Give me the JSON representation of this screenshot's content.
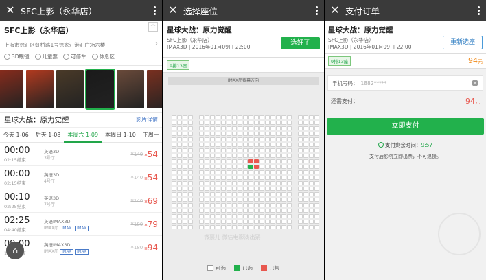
{
  "panel1": {
    "title": "SFC上影（永华店）",
    "cinema_name": "SFC上影（永华店）",
    "address": "上海市徐汇区虹桥路1号徐家汇港汇广场六楼",
    "tags": [
      "3D眼镜",
      "儿童票",
      "可停车",
      "休息区"
    ],
    "movie_title": "星球大战：原力觉醒",
    "movie_detail": "影片详情",
    "dates": [
      "今天 1-06",
      "后天 1-08",
      "本周六 1-09",
      "本周日 1-10",
      "下周一"
    ],
    "active_date_index": 2,
    "showtimes": [
      {
        "time": "00:00",
        "end": "02:15结束",
        "lang": "英语3D",
        "hall": "3号厅",
        "imax": false,
        "old_price": "¥140",
        "price": "54"
      },
      {
        "time": "00:00",
        "end": "02:15结束",
        "lang": "英语3D",
        "hall": "4号厅",
        "imax": false,
        "old_price": "¥140",
        "price": "54"
      },
      {
        "time": "00:10",
        "end": "02:25结束",
        "lang": "英语3D",
        "hall": "7号厅",
        "imax": false,
        "old_price": "¥140",
        "price": "69"
      },
      {
        "time": "02:25",
        "end": "04:40结束",
        "lang": "英语IMAX3D",
        "hall": "IMAX厅",
        "imax": true,
        "imax_labels": [
          "IMAX",
          "IMAX"
        ],
        "old_price": "¥180",
        "price": "79"
      },
      {
        "time": "09:00",
        "end": "11:15结束",
        "lang": "英语IMAX3D",
        "hall": "IMAX厅",
        "imax": true,
        "imax_labels": [
          "IMAX",
          "IMAX"
        ],
        "old_price": "¥180",
        "price": "94"
      }
    ],
    "poster_colors": [
      "#8a2c1c",
      "#b23a1f",
      "#4a3a28",
      "#1a1a1a",
      "#6a4a3a",
      "#7a3020"
    ]
  },
  "panel2": {
    "title": "选择座位",
    "movie_name": "星球大战：原力觉醒",
    "cinema": "SFC上影（永华店）",
    "session": "IMAX3D | 2016年01月09日 22:00",
    "confirm_label": "选好了",
    "hall_chip": "9排13座",
    "screen_label": "IMAX厅银幕方向",
    "watermark": "微票儿  微信电影演出票",
    "legend": [
      "可选",
      "已选",
      "已售"
    ]
  },
  "panel3": {
    "title": "支付订单",
    "movie_name": "星球大战：原力觉醒",
    "cinema": "SFC上影（永华店）",
    "session": "IMAX3D | 2016年01月09日 22:00",
    "reselect_label": "重新选座",
    "hall_chip": "9排13座",
    "price": "94",
    "price_unit": "元",
    "phone_label": "手机号码：",
    "phone_value": "1882*****",
    "pay_label": "还需支付：",
    "pay_amount": "94",
    "pay_unit": "元",
    "pay_button": "立即支付",
    "remain_label": "支付剩余时间：",
    "remain_time": "9:57",
    "note": "支付后影院立即出票，不可退换。"
  },
  "colors": {
    "green": "#22b14c",
    "red": "#e8584f",
    "blue": "#4a7bc8",
    "orange": "#f08a1a",
    "topbar": "#3a3a3a"
  }
}
